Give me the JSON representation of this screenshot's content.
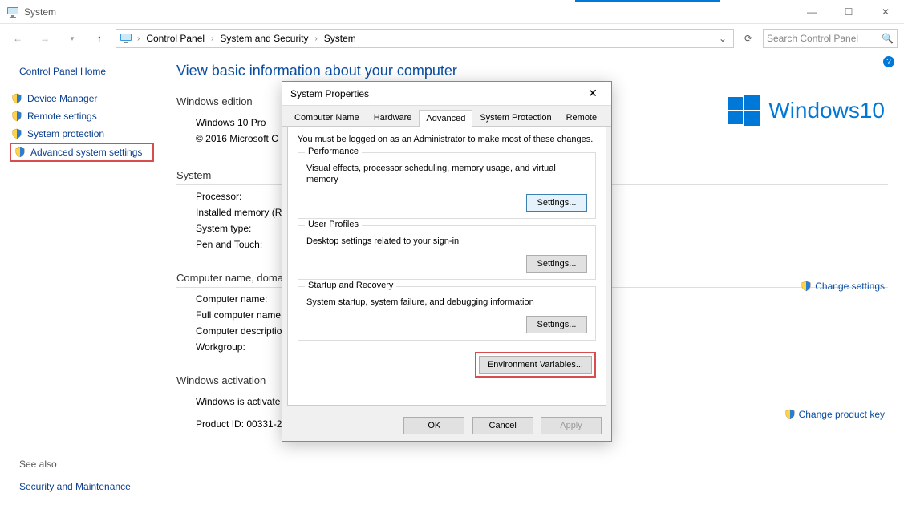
{
  "window": {
    "title": "System",
    "min": "—",
    "max": "☐",
    "close": "✕"
  },
  "address": {
    "crumbs": [
      "Control Panel",
      "System and Security",
      "System"
    ],
    "search_placeholder": "Search Control Panel"
  },
  "sidebar": {
    "home": "Control Panel Home",
    "links": [
      "Device Manager",
      "Remote settings",
      "System protection",
      "Advanced system settings"
    ],
    "see_also": "See also",
    "sm": "Security and Maintenance"
  },
  "content": {
    "heading": "View basic information about your computer",
    "win_edition_title": "Windows edition",
    "win_edition_rows": [
      "Windows 10 Pro",
      "© 2016 Microsoft C"
    ],
    "system_title": "System",
    "system_rows": [
      "Processor:",
      "Installed memory (R",
      "System type:",
      "Pen and Touch:"
    ],
    "cnd_title": "Computer name, doma",
    "cnd_rows": [
      "Computer name:",
      "Full computer name",
      "Computer descriptio",
      "Workgroup:"
    ],
    "activation_title": "Windows activation",
    "activation_rows": [
      "Windows is activate",
      "Product ID: 00331-2"
    ],
    "change_settings": "Change settings",
    "change_product_key": "Change product key",
    "win10_text": "Windows10"
  },
  "dialog": {
    "title": "System Properties",
    "tabs": [
      "Computer Name",
      "Hardware",
      "Advanced",
      "System Protection",
      "Remote"
    ],
    "active_tab": 2,
    "note": "You must be logged on as an Administrator to make most of these changes.",
    "groups": [
      {
        "title": "Performance",
        "desc": "Visual effects, processor scheduling, memory usage, and virtual memory",
        "btn": "Settings..."
      },
      {
        "title": "User Profiles",
        "desc": "Desktop settings related to your sign-in",
        "btn": "Settings..."
      },
      {
        "title": "Startup and Recovery",
        "desc": "System startup, system failure, and debugging information",
        "btn": "Settings..."
      }
    ],
    "env_btn": "Environment Variables...",
    "ok": "OK",
    "cancel": "Cancel",
    "apply": "Apply"
  }
}
